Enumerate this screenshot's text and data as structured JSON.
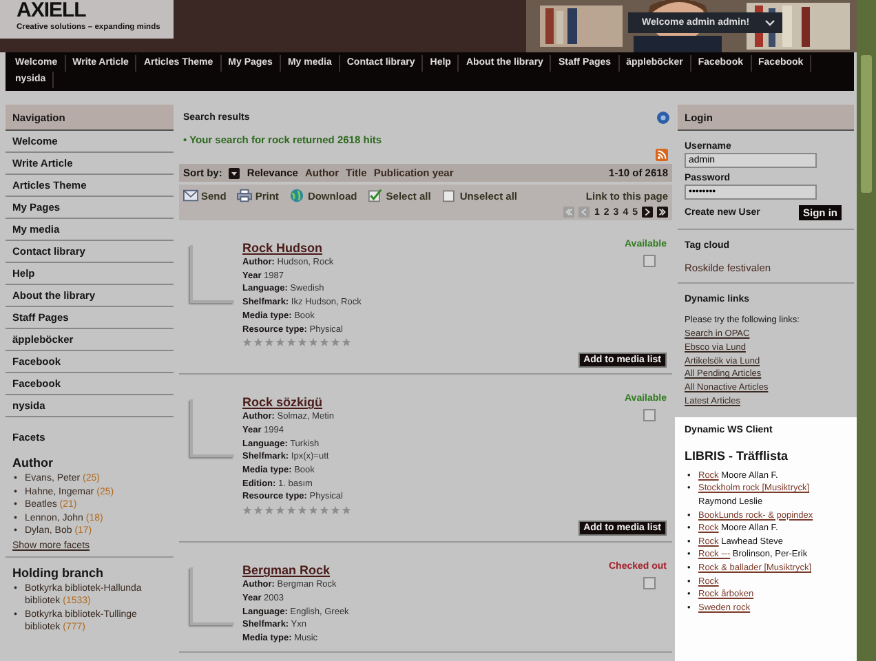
{
  "header": {
    "logo": "AXIELL",
    "tagline": "Creative solutions – expanding minds",
    "welcome": "Welcome admin admin!"
  },
  "menu": [
    "Welcome",
    "Write Article",
    "Articles Theme",
    "My Pages",
    "My media",
    "Contact library",
    "Help",
    "About the library",
    "Staff Pages",
    "äppleböcker",
    "Facebook",
    "Facebook",
    "nysida"
  ],
  "navigation": {
    "title": "Navigation",
    "items": [
      "Welcome",
      "Write Article",
      "Articles Theme",
      "My Pages",
      "My media",
      "Contact library",
      "Help",
      "About the library",
      "Staff Pages",
      "äppleböcker",
      "Facebook",
      "Facebook",
      "nysida"
    ]
  },
  "facets": {
    "title": "Facets",
    "groups": [
      {
        "title": "Author",
        "marker": "•",
        "items": [
          {
            "label": "Evans, Peter",
            "count": "(25)"
          },
          {
            "label": "Hahne, Ingemar",
            "count": "(25)"
          },
          {
            "label": "Beatles",
            "count": "(21)"
          },
          {
            "label": "Lennon, John",
            "count": "(18)"
          },
          {
            "label": "Dylan, Bob",
            "count": "(17)"
          }
        ],
        "more": "Show more facets"
      },
      {
        "title": "Holding branch",
        "marker": "•",
        "items": [
          {
            "label": "Botkyrka bibliotek-Hallunda bibliotek",
            "count": "(1533)"
          },
          {
            "label": "Botkyrka bibliotek-Tullinge bibliotek",
            "count": "(777)"
          }
        ]
      }
    ]
  },
  "search": {
    "title": "Search results",
    "message": "• Your search for rock returned 2618 hits",
    "sort_label": "Sort by:",
    "sort_options": [
      {
        "label": "Relevance",
        "selected": true
      },
      {
        "label": "Author",
        "selected": false
      },
      {
        "label": "Title",
        "selected": false
      },
      {
        "label": "Publication year",
        "selected": false
      }
    ],
    "range": "1-10 of 2618",
    "actions": [
      {
        "kind": "send",
        "label": "Send"
      },
      {
        "kind": "print",
        "label": "Print"
      },
      {
        "kind": "download",
        "label": "Download"
      },
      {
        "kind": "select",
        "label": "Select all"
      },
      {
        "kind": "unselect",
        "label": "Unselect all"
      }
    ],
    "permalink": "Link to this page",
    "pages": [
      "1",
      "2",
      "3",
      "4",
      "5"
    ]
  },
  "results": [
    {
      "title": "Rock Hudson",
      "fields": [
        {
          "label": "Author:",
          "value": "Hudson, Rock"
        },
        {
          "label": "Year",
          "value": "1987"
        },
        {
          "label": "Language:",
          "value": "Swedish"
        },
        {
          "label": "Shelfmark:",
          "value": "Ikz Hudson, Rock"
        },
        {
          "label": "Media type:",
          "value": "Book"
        },
        {
          "label": "Resource type:",
          "value": "Physical"
        }
      ],
      "status": {
        "text": "Available",
        "color": "#2f7a1e"
      },
      "checked": false,
      "stars": 0,
      "button": "Add to media list"
    },
    {
      "title": "Rock sözkigü",
      "fields": [
        {
          "label": "Author:",
          "value": "Solmaz, Metin"
        },
        {
          "label": "Year",
          "value": "1994"
        },
        {
          "label": "Language:",
          "value": "Turkish"
        },
        {
          "label": "Shelfmark:",
          "value": "Ipx(x)=utt"
        },
        {
          "label": "Media type:",
          "value": "Book"
        },
        {
          "label": "Edition:",
          "value": "1. basım"
        },
        {
          "label": "Resource type:",
          "value": "Physical"
        }
      ],
      "status": {
        "text": "Available",
        "color": "#2f7a1e"
      },
      "checked": false,
      "stars": 0,
      "button": "Add to media list"
    },
    {
      "title": "Bergman Rock",
      "fields": [
        {
          "label": "Author:",
          "value": "Bergman Rock"
        },
        {
          "label": "Year",
          "value": "2003"
        },
        {
          "label": "Language:",
          "value": "English, Greek"
        },
        {
          "label": "Shelfmark:",
          "value": "Yxn"
        },
        {
          "label": "Media type:",
          "value": "Music"
        }
      ],
      "status": {
        "text": "Checked out",
        "color": "#a3202a"
      },
      "checked": false
    }
  ],
  "login": {
    "title": "Login",
    "username_label": "Username",
    "username": "admin",
    "password_label": "Password",
    "password": "••••••••",
    "create": "Create new User",
    "sign_in": "Sign in"
  },
  "tag_cloud": {
    "title": "Tag cloud",
    "tags": [
      "Roskilde festivalen"
    ]
  },
  "dynamic_links": {
    "title": "Dynamic links",
    "intro": "Please try the following links:",
    "links": [
      "Search in OPAC",
      "Ebsco via Lund",
      "Artikelsök via Lund",
      "All Pending Articles",
      "All Nonactive Articles",
      "Latest Articles"
    ]
  },
  "ws_client": {
    "title": "Dynamic WS Client",
    "heading": "LIBRIS - Träfflista",
    "marker": "•",
    "items": [
      {
        "link": "Rock",
        "text": "Moore Allan F."
      },
      {
        "link": "Stockholm rock [Musiktryck]",
        "text": "Raymond Leslie"
      },
      {
        "link": "BookLunds rock- & popindex"
      },
      {
        "link": "Rock",
        "text": "Moore Allan F."
      },
      {
        "link": "Rock",
        "text": "Lawhead Steve"
      },
      {
        "link": "Rock ---",
        "text": "Brolinson, Per-Erik"
      },
      {
        "link": "Rock & ballader [Musiktryck]"
      },
      {
        "link": "Rock"
      },
      {
        "link": "Rock årboken"
      },
      {
        "link": "Sweden rock"
      }
    ]
  }
}
